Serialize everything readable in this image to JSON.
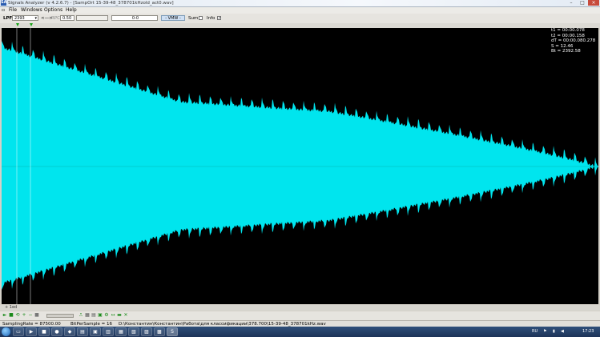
{
  "window": {
    "title": "Signals Analyzer (v 4.2.6.7) - [SampOrt 15-39-48_378701kHzold_act0.wav]",
    "app_icon": "SA"
  },
  "menu": [
    "File",
    "Windows",
    "Options",
    "Help"
  ],
  "toolbar": {
    "lpf_label": "LPF",
    "lpf_value": "2393",
    "rpc_arrow": "<—>",
    "rpc_label": "RPC",
    "rpc_value": "0.50",
    "range_value": "0-0",
    "vmw_label": "- VMW -",
    "sum_label": "Sum",
    "info_label": "Info"
  },
  "readout": [
    "t1 = 00:00.078",
    "t2 = 00:00.158",
    "dT = 00:00.080.278",
    "S = 12.46",
    "Bt = 2392.58"
  ],
  "bottom_label": "+ 1ed",
  "status": {
    "sampling_rate": "SamplingRate = 87500.00",
    "bits": "BitPerSample = 16",
    "path": "D:\\Константин\\Константин\\Работа\\для классификации\\378.700\\15-39-48_378701kHz.wav"
  },
  "taskbar": {
    "lang": "RU",
    "time": "17:23"
  },
  "colors": {
    "waveform": "#00e5ee",
    "background": "#000000",
    "axis": "#00c8c8",
    "marker": "#16a316"
  },
  "icons": [
    "app-icon",
    "play-icon",
    "stop-icon",
    "zoom-in-icon",
    "zoom-out-icon",
    "marker-icon",
    "close-icon"
  ]
}
